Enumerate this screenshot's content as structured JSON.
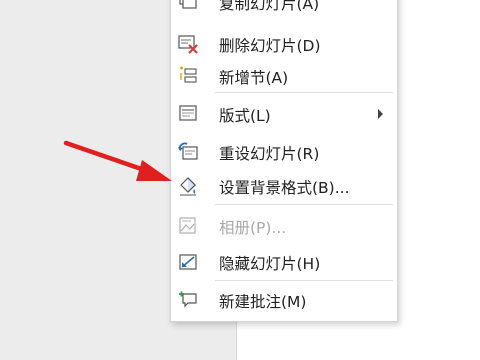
{
  "context_menu": {
    "items": [
      {
        "label": "复制幻灯片(A)",
        "icon": "duplicate-slide-icon"
      },
      {
        "label": "删除幻灯片(D)",
        "icon": "delete-slide-icon"
      },
      {
        "label": "新增节(A)",
        "icon": "add-section-icon"
      },
      {
        "label": "版式(L)",
        "icon": "layout-icon"
      },
      {
        "label": "重设幻灯片(R)",
        "icon": "reset-slide-icon"
      },
      {
        "label": "设置背景格式(B)...",
        "icon": "format-background-icon"
      },
      {
        "label": "相册(P)...",
        "icon": "photo-album-icon",
        "disabled": true
      },
      {
        "label": "隐藏幻灯片(H)",
        "icon": "hide-slide-icon"
      },
      {
        "label": "新建批注(M)",
        "icon": "new-comment-icon"
      }
    ]
  },
  "colors": {
    "annotation_arrow": "#e02020",
    "delete_red": "#d83b3b",
    "icon_blue": "#2b6cb0",
    "icon_gold": "#d9a400"
  }
}
